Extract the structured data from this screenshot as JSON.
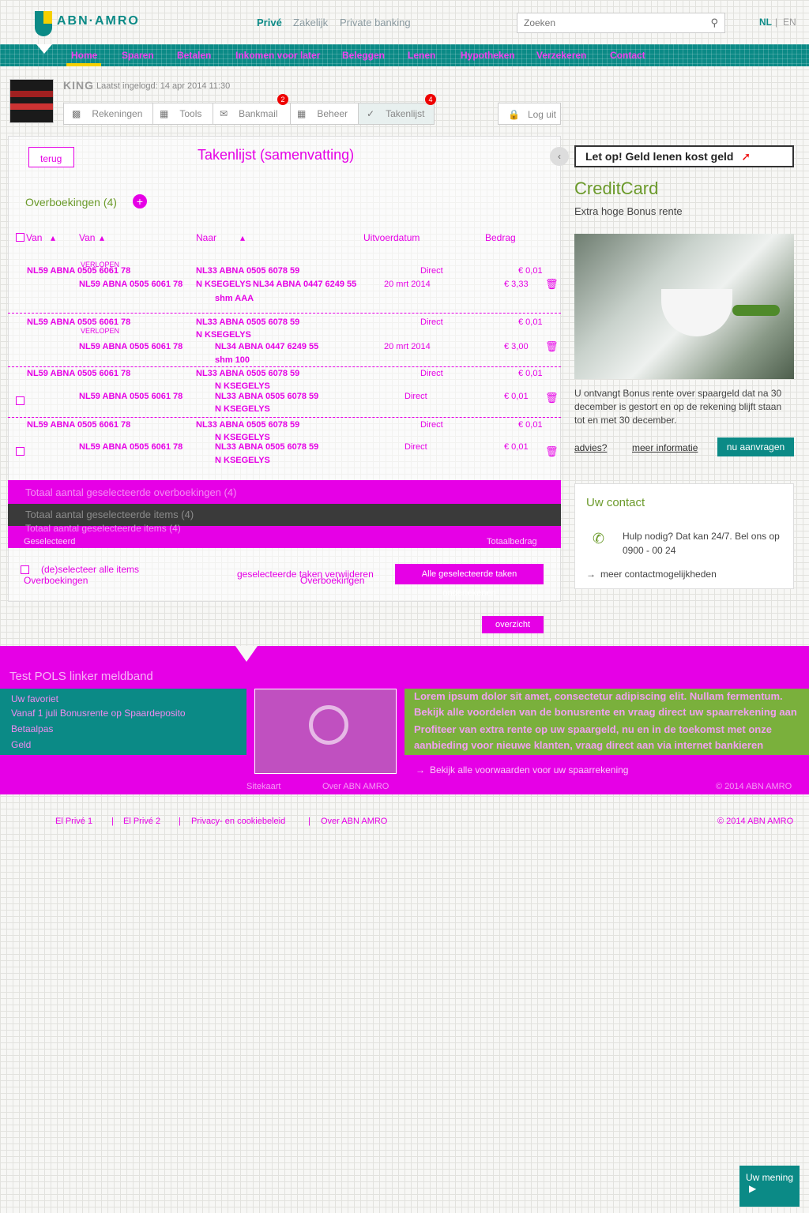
{
  "header": {
    "logo": "ABN·AMRO",
    "topnav": [
      "Privé",
      "Zakelijk",
      "Private banking"
    ],
    "search_placeholder": "Zoeken",
    "lang_nl": "NL",
    "lang_sep": "|",
    "lang_en": "EN"
  },
  "mainnav": [
    "Home",
    "Sparen",
    "Betalen",
    "Inkomen voor later",
    "Beleggen",
    "Lenen",
    "Hypotheken",
    "Verzekeren",
    "Contact"
  ],
  "user": {
    "name": "KING",
    "last_login": "Laatst ingelogd: 14 apr 2014 11:30",
    "tabs": [
      "Rekeningen",
      "Tools",
      "Bankmail",
      "Beheer",
      "Takenlijst"
    ],
    "badge_bankmail": "2",
    "badge_takenlijst": "4",
    "logout": "Log uit"
  },
  "main": {
    "back": "terug",
    "title": "Takenlijst (samenvatting)",
    "section": "Overboekingen (4)",
    "columns": {
      "van": "Van",
      "naar": "Naar",
      "uitvoerdatum": "Uitvoerdatum",
      "bedrag": "Bedrag"
    },
    "rows": [
      {
        "van1": "NL59 ABNA 0505 6061 78",
        "van_label": "VERLOPEN",
        "van2": "NL59 ABNA 0505 6061 78",
        "naar1": "NL33 ABNA 0505 6078 59",
        "naar2": "N KSEGELYS",
        "naar3": "NL34 ABNA 0447 6249 55",
        "naar4": "shm AAA",
        "date1": "Direct",
        "date2": "20 mrt 2014",
        "amt1": "€ 0,01",
        "amt2": "€ 3,33"
      },
      {
        "van1": "NL59 ABNA 0505 6061 78",
        "van_label": "VERLOPEN",
        "van2": "NL59 ABNA 0505 6061 78",
        "naar1": "NL33 ABNA 0505 6078 59",
        "naar2": "N KSEGELYS",
        "naar3": "NL34 ABNA 0447 6249 55",
        "naar4": "shm 100",
        "date1": "Direct",
        "date2": "20 mrt 2014",
        "amt1": "€ 0,01",
        "amt2": "€ 3,00"
      },
      {
        "van1": "NL59 ABNA 0505 6061 78",
        "van2": "NL59 ABNA 0505 6061 78",
        "naar1": "NL33 ABNA 0505 6078 59",
        "naar2": "N KSEGELYS",
        "naar3": "NL33 ABNA 0505 6078 59",
        "naar4": "N KSEGELYS",
        "date1": "Direct",
        "date2": "Direct",
        "amt1": "€ 0,01",
        "amt2": "€ 0,01"
      },
      {
        "van1": "NL59 ABNA 0505 6061 78",
        "van2": "NL59 ABNA 0505 6061 78",
        "naar1": "NL33 ABNA 0505 6078 59",
        "naar2": "N KSEGELYS",
        "naar3": "NL33 ABNA 0505 6078 59",
        "naar4": "N KSEGELYS",
        "date1": "Direct",
        "date2": "Direct",
        "amt1": "€ 0,01",
        "amt2": "€ 0,01"
      }
    ],
    "totals_1": "Totaal aantal geselecteerde overboekingen (4)",
    "totals_2": "Totaal aantal geselecteerde items (4)",
    "totals_3": "Totaal aantal geselecteerde items (4)",
    "selected_label": "Geselecteerd",
    "total_amount_label": "Totaalbedrag",
    "deselect_all": "(de)selecteer alle items",
    "overboekingen": "Overboekingen",
    "delete_selected": "geselecteerde taken verwijderen",
    "overboekingen_2": "Overboekingen",
    "confirm_selected": "Alle geselecteerde taken ondertekenen",
    "overview": "overzicht"
  },
  "sidebar": {
    "promo": "Let op! Geld lenen kost geld",
    "cc_title": "CreditCard",
    "cc_sub": "Extra hoge Bonus rente",
    "cc_desc": "U ontvangt Bonus rente over spaargeld dat na 30 december is gestort en op de rekening blijft staan tot en met 30 december.",
    "links": [
      "advies?",
      "meer informatie"
    ],
    "cta": "nu aanvragen",
    "contact_title": "Uw contact",
    "contact_help": "Hulp nodig? Dat kan 24/7. Bel ons op 0900 - 00 24",
    "contact_more": "meer contactmogelijkheden"
  },
  "footer": {
    "title": "Test POLS  linker  meldband",
    "teal_items": [
      "Uw favoriet",
      "Vanaf 1 juli Bonusrente op Spaardeposito",
      "Betaalpas",
      "Geld"
    ],
    "green_lines": [
      "Lorem ipsum dolor sit amet, consectetur adipiscing elit. Nullam fermentum.",
      "Bekijk alle voordelen van de bonusrente en vraag direct uw spaarrekening aan",
      "Profiteer van extra rente op uw spaargeld, nu en in de toekomst met onze",
      "aanbieding voor nieuwe klanten, vraag direct aan via internet bankieren"
    ],
    "green_link": "Bekijk alle voorwaarden voor uw spaarrekening",
    "bottom_links": [
      "El Privé 1",
      "|",
      "El Privé 2",
      "|",
      "Privacy- en cookiebeleid",
      "|",
      "Over ABN AMRO"
    ],
    "copyright": "© 2014 ABN AMRO",
    "footer_mid": [
      "Sitekaart",
      "Over ABN AMRO",
      "© 2014 ABN AMRO"
    ]
  },
  "feedback": "Uw mening"
}
